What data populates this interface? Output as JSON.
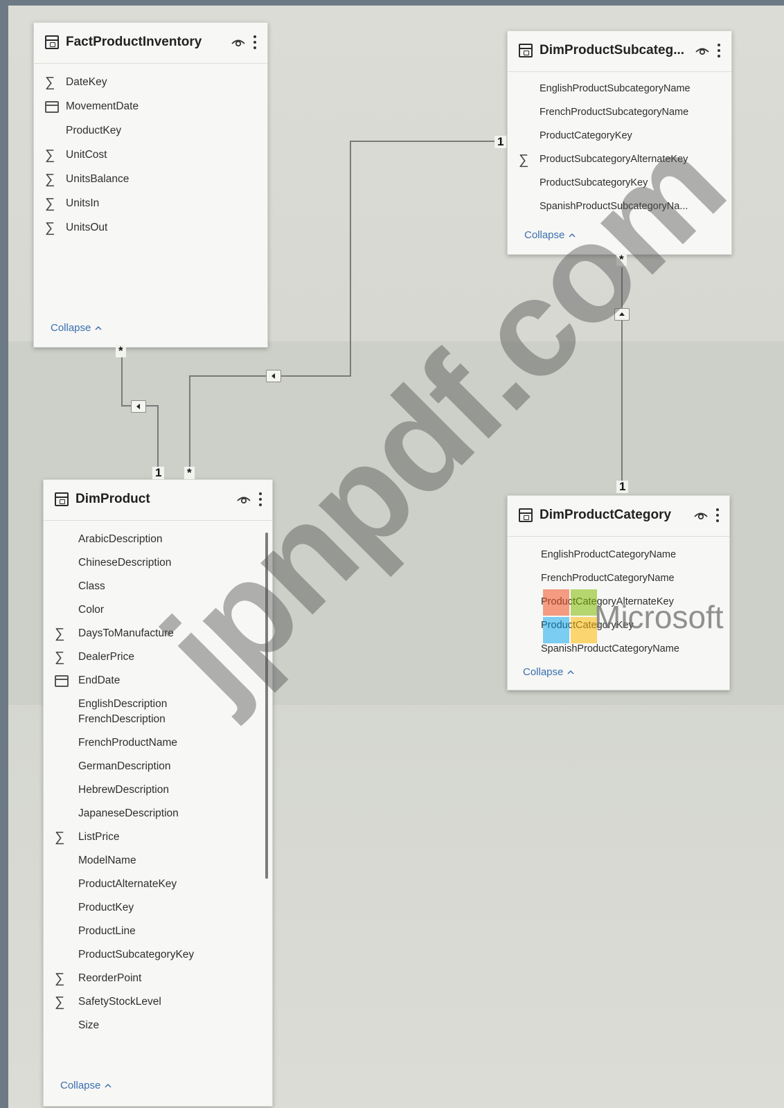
{
  "tables": [
    {
      "id": "fact_product_inventory",
      "title": "FactProductInventory",
      "fields": [
        {
          "name": "DateKey",
          "icon": "sigma"
        },
        {
          "name": "MovementDate",
          "icon": "calendar"
        },
        {
          "name": "ProductKey",
          "icon": ""
        },
        {
          "name": "UnitCost",
          "icon": "sigma"
        },
        {
          "name": "UnitsBalance",
          "icon": "sigma"
        },
        {
          "name": "UnitsIn",
          "icon": "sigma"
        },
        {
          "name": "UnitsOut",
          "icon": "sigma"
        }
      ],
      "collapse_label": "Collapse"
    },
    {
      "id": "dim_product_subcategory",
      "title": "DimProductSubcateg...",
      "fields": [
        {
          "name": "EnglishProductSubcategoryName",
          "icon": ""
        },
        {
          "name": "FrenchProductSubcategoryName",
          "icon": ""
        },
        {
          "name": "ProductCategoryKey",
          "icon": ""
        },
        {
          "name": "ProductSubcategoryAlternateKey",
          "icon": "sigma"
        },
        {
          "name": "ProductSubcategoryKey",
          "icon": ""
        },
        {
          "name": "SpanishProductSubcategoryNa...",
          "icon": ""
        }
      ],
      "collapse_label": "Collapse"
    },
    {
      "id": "dim_product",
      "title": "DimProduct",
      "fields": [
        {
          "name": "ArabicDescription",
          "icon": ""
        },
        {
          "name": "ChineseDescription",
          "icon": ""
        },
        {
          "name": "Class",
          "icon": ""
        },
        {
          "name": "Color",
          "icon": ""
        },
        {
          "name": "DaysToManufacture",
          "icon": "sigma"
        },
        {
          "name": "DealerPrice",
          "icon": "sigma"
        },
        {
          "name": "EndDate",
          "icon": "calendar"
        },
        {
          "name": "EnglishDescription",
          "icon": ""
        },
        {
          "name": "FrenchDescription",
          "icon": ""
        },
        {
          "name": "FrenchProductName",
          "icon": ""
        },
        {
          "name": "GermanDescription",
          "icon": ""
        },
        {
          "name": "HebrewDescription",
          "icon": ""
        },
        {
          "name": "JapaneseDescription",
          "icon": ""
        },
        {
          "name": "ListPrice",
          "icon": "sigma"
        },
        {
          "name": "ModelName",
          "icon": ""
        },
        {
          "name": "ProductAlternateKey",
          "icon": ""
        },
        {
          "name": "ProductKey",
          "icon": ""
        },
        {
          "name": "ProductLine",
          "icon": ""
        },
        {
          "name": "ProductSubcategoryKey",
          "icon": ""
        },
        {
          "name": "ReorderPoint",
          "icon": "sigma"
        },
        {
          "name": "SafetyStockLevel",
          "icon": "sigma"
        },
        {
          "name": "Size",
          "icon": ""
        }
      ],
      "collapse_label": "Collapse"
    },
    {
      "id": "dim_product_category",
      "title": "DimProductCategory",
      "fields": [
        {
          "name": "EnglishProductCategoryName",
          "icon": ""
        },
        {
          "name": "FrenchProductCategoryName",
          "icon": ""
        },
        {
          "name": "ProductCategoryAlternateKey",
          "icon": ""
        },
        {
          "name": "ProductCategoryKey",
          "icon": ""
        },
        {
          "name": "SpanishProductCategoryName",
          "icon": ""
        }
      ],
      "collapse_label": "Collapse"
    }
  ],
  "relationships": [
    {
      "from": "DimProduct",
      "to": "FactProductInventory",
      "from_cardinality": "1",
      "to_cardinality": "*",
      "filter_direction": "single"
    },
    {
      "from": "DimProductSubcategory",
      "to": "DimProduct",
      "from_cardinality": "1",
      "to_cardinality": "*",
      "filter_direction": "single"
    },
    {
      "from": "DimProductCategory",
      "to": "DimProductSubcategory",
      "from_cardinality": "1",
      "to_cardinality": "*",
      "filter_direction": "single"
    }
  ],
  "cardinality_labels": {
    "one": "1",
    "many": "*"
  },
  "watermark": {
    "text": "jpnpdf.com",
    "brand": "Microsoft"
  },
  "colors": {
    "canvas": "#d7d8d2",
    "card": "#f7f7f5",
    "collapse_link": "#3a6fb0",
    "relationship_line": "#7a7a7a",
    "ms_red": "#f25022",
    "ms_green": "#7fba00",
    "ms_blue": "#00a4ef",
    "ms_yellow": "#ffb900"
  }
}
